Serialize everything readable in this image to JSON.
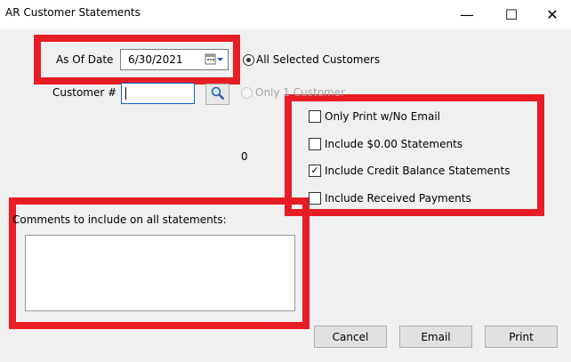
{
  "window": {
    "title": "AR Customer Statements",
    "minimize_glyph": "—",
    "maximize_glyph": "☐",
    "close_glyph": "✕"
  },
  "as_of_date": {
    "label": "As Of Date",
    "value": "6/30/2021"
  },
  "customer_scope": {
    "all_label": "All Selected Customers",
    "all_selected": true,
    "one_label": "Only 1 Customer"
  },
  "customer_number": {
    "label": "Customer #",
    "value": ""
  },
  "count": "0",
  "options": [
    {
      "label": "Only Print w/No Email",
      "checked": false
    },
    {
      "label": "Include $0.00 Statements",
      "checked": false
    },
    {
      "label": "Include Credit Balance Statements",
      "checked": true
    },
    {
      "label": "Include Received Payments",
      "checked": false
    }
  ],
  "comments": {
    "label": "Comments to include on all statements:",
    "value": ""
  },
  "buttons": {
    "cancel": "Cancel",
    "email": "Email",
    "print": "Print"
  },
  "colors": {
    "highlight": "#e81c24",
    "focus": "#0a66c8"
  }
}
